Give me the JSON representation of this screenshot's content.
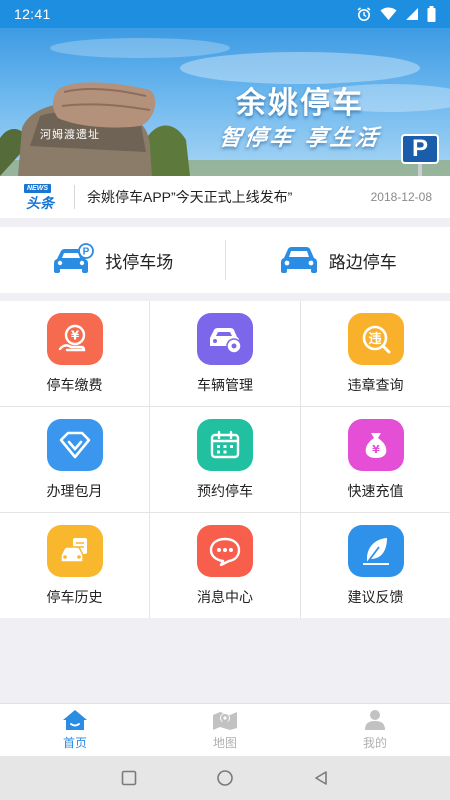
{
  "status_bar": {
    "time": "12:41",
    "icons": [
      "alarm-icon",
      "wifi-icon",
      "signal-icon",
      "battery-icon"
    ]
  },
  "banner": {
    "title": "余姚停车",
    "slogan": "智停车 享生活",
    "sign_letter": "P",
    "rock_text": "河姆渡遗址"
  },
  "news": {
    "logo_tag": "NEWS",
    "logo_word": "头条",
    "headline": "余姚停车APP”今天正式上线发布”",
    "date": "2018-12-08"
  },
  "quick_actions": [
    {
      "label": "找停车场",
      "icon": "car-parking-icon"
    },
    {
      "label": "路边停车",
      "icon": "car-icon"
    }
  ],
  "services": [
    {
      "label": "停车缴费",
      "icon": "payment-icon",
      "color": "#f66a4f"
    },
    {
      "label": "车辆管理",
      "icon": "car-settings-icon",
      "color": "#7c67ea"
    },
    {
      "label": "违章查询",
      "icon": "violation-search-icon",
      "color": "#f9b12b"
    },
    {
      "label": "办理包月",
      "icon": "diamond-icon",
      "color": "#3b97ee"
    },
    {
      "label": "预约停车",
      "icon": "calendar-icon",
      "color": "#20c0a0"
    },
    {
      "label": "快速充值",
      "icon": "money-bag-icon",
      "color": "#e44fd6"
    },
    {
      "label": "停车历史",
      "icon": "history-icon",
      "color": "#f8b72c"
    },
    {
      "label": "消息中心",
      "icon": "message-icon",
      "color": "#f75e4c"
    },
    {
      "label": "建议反馈",
      "icon": "feather-icon",
      "color": "#2e92ea"
    }
  ],
  "tabs": [
    {
      "label": "首页",
      "icon": "home-icon",
      "active": true
    },
    {
      "label": "地图",
      "icon": "map-icon",
      "active": false
    },
    {
      "label": "我的",
      "icon": "profile-icon",
      "active": false
    }
  ],
  "colors": {
    "primary": "#2a8ce3",
    "tab_inactive": "#b0b0b0"
  }
}
